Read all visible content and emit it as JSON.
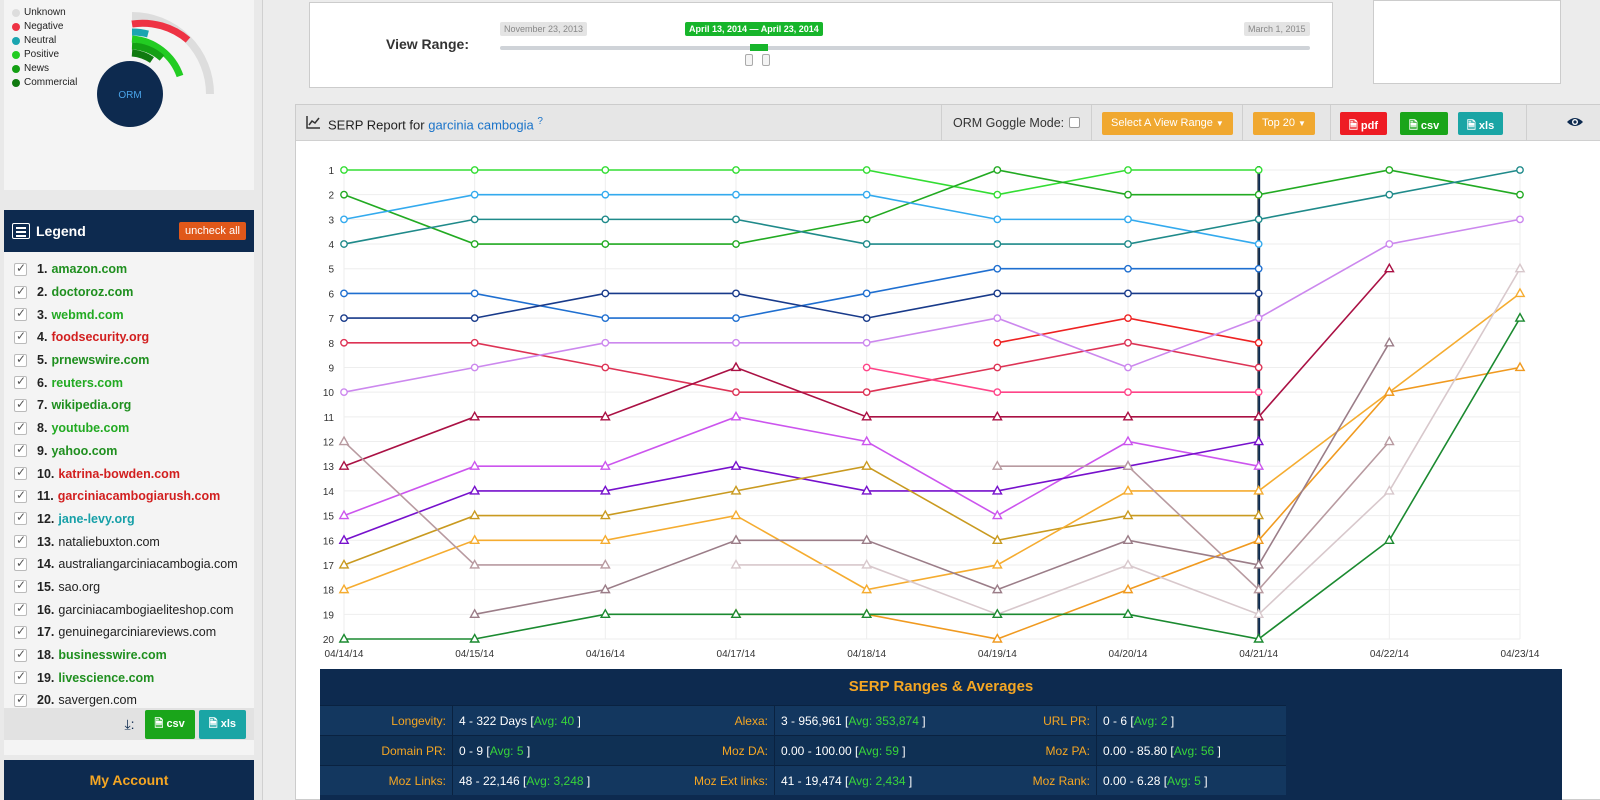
{
  "orm_legend": [
    {
      "label": "Unknown",
      "color": "#dddddd"
    },
    {
      "label": "Negative",
      "color": "#ee3344"
    },
    {
      "label": "Neutral",
      "color": "#1aa5b0"
    },
    {
      "label": "Positive",
      "color": "#22cc22"
    },
    {
      "label": "News",
      "color": "#14a014"
    },
    {
      "label": "Commercial",
      "color": "#107a10"
    }
  ],
  "orm_gauge_label": "ORM",
  "legend": {
    "title": "Legend",
    "uncheck_all": "uncheck all",
    "items": [
      {
        "num": "1.",
        "name": "amazon.com",
        "color": "#1f8f1f"
      },
      {
        "num": "2.",
        "name": "doctoroz.com",
        "color": "#1f8f1f"
      },
      {
        "num": "3.",
        "name": "webmd.com",
        "color": "#22aa22"
      },
      {
        "num": "4.",
        "name": "foodsecurity.org",
        "color": "#d21f1f"
      },
      {
        "num": "5.",
        "name": "prnewswire.com",
        "color": "#1f8f1f"
      },
      {
        "num": "6.",
        "name": "reuters.com",
        "color": "#22aa22"
      },
      {
        "num": "7.",
        "name": "wikipedia.org",
        "color": "#1f8f1f"
      },
      {
        "num": "8.",
        "name": "youtube.com",
        "color": "#22aa22"
      },
      {
        "num": "9.",
        "name": "yahoo.com",
        "color": "#1f8f1f"
      },
      {
        "num": "10.",
        "name": "katrina-bowden.com",
        "color": "#d21f1f"
      },
      {
        "num": "11.",
        "name": "garciniacambogiarush.com",
        "color": "#d21f1f"
      },
      {
        "num": "12.",
        "name": "jane-levy.org",
        "color": "#17a0a8"
      },
      {
        "num": "13.",
        "name": "nataliebuxton.com",
        "color": "plain"
      },
      {
        "num": "14.",
        "name": "australiangarciniacambogia.com",
        "color": "plain"
      },
      {
        "num": "15.",
        "name": "sao.org",
        "color": "plain"
      },
      {
        "num": "16.",
        "name": "garciniacambogiaeliteshop.com",
        "color": "plain"
      },
      {
        "num": "17.",
        "name": "genuinegarciniareviews.com",
        "color": "plain"
      },
      {
        "num": "18.",
        "name": "businesswire.com",
        "color": "#1f8f1f"
      },
      {
        "num": "19.",
        "name": "livescience.com",
        "color": "#1f8f1f"
      },
      {
        "num": "20.",
        "name": "savergen.com",
        "color": "plain"
      }
    ]
  },
  "export": {
    "csv": "csv",
    "xls": "xls"
  },
  "my_account": "My Account",
  "view_range": {
    "label": "View Range:",
    "start": "November 23, 2013",
    "end": "March 1, 2015",
    "selected": "April 13, 2014 — April 23, 2014"
  },
  "serp": {
    "title_prefix": "SERP Report for",
    "keyword": "garcinia cambogia",
    "help": "?",
    "goggle_mode": "ORM Goggle Mode:",
    "select_range": "Select A View Range",
    "top": "Top 20",
    "pdf": "pdf",
    "csv": "csv",
    "xls": "xls"
  },
  "chart_data": {
    "type": "line",
    "title": "",
    "y_reversed": true,
    "y_ticks": [
      1,
      2,
      3,
      4,
      5,
      6,
      7,
      8,
      9,
      10,
      11,
      12,
      13,
      14,
      15,
      16,
      17,
      18,
      19,
      20
    ],
    "categories": [
      "04/14/14",
      "04/15/14",
      "04/16/14",
      "04/17/14",
      "04/18/14",
      "04/19/14",
      "04/20/14",
      "04/21/14",
      "04/22/14",
      "04/23/14"
    ],
    "current_date_marker": "04/21/14",
    "series": [
      {
        "color": "#33dd33",
        "marker": "circle",
        "values": [
          1,
          1,
          1,
          1,
          1,
          2,
          1,
          1,
          null,
          null
        ]
      },
      {
        "color": "#22aa22",
        "marker": "circle",
        "values": [
          2,
          4,
          4,
          4,
          3,
          1,
          2,
          2,
          1,
          2
        ]
      },
      {
        "color": "#33aaee",
        "marker": "circle",
        "values": [
          3,
          2,
          2,
          2,
          2,
          3,
          3,
          4,
          null,
          null
        ]
      },
      {
        "color": "#1f8a8a",
        "marker": "circle",
        "values": [
          4,
          3,
          3,
          3,
          4,
          4,
          4,
          3,
          2,
          1
        ]
      },
      {
        "color": "#1f6fd0",
        "marker": "circle",
        "values": [
          6,
          6,
          7,
          7,
          6,
          5,
          5,
          5,
          null,
          null
        ]
      },
      {
        "color": "#183a8a",
        "marker": "circle",
        "values": [
          7,
          7,
          6,
          6,
          7,
          6,
          6,
          6,
          null,
          null
        ]
      },
      {
        "color": "#dd3355",
        "marker": "circle",
        "values": [
          8,
          8,
          9,
          10,
          10,
          9,
          8,
          9,
          null,
          null
        ]
      },
      {
        "color": "#ee2222",
        "marker": "circle",
        "values": [
          null,
          null,
          null,
          null,
          null,
          8,
          7,
          8,
          null,
          null
        ]
      },
      {
        "color": "#ff4488",
        "marker": "circle",
        "values": [
          null,
          null,
          null,
          null,
          9,
          10,
          10,
          10,
          null,
          null
        ]
      },
      {
        "color": "#cc88ee",
        "marker": "circle",
        "values": [
          10,
          9,
          8,
          8,
          8,
          7,
          9,
          7,
          4,
          3
        ]
      },
      {
        "color": "#aa1144",
        "marker": "triangle",
        "values": [
          13,
          11,
          11,
          9,
          11,
          11,
          11,
          11,
          5,
          null
        ]
      },
      {
        "color": "#cc55ee",
        "marker": "triangle",
        "values": [
          15,
          13,
          13,
          11,
          12,
          15,
          12,
          13,
          null,
          null
        ]
      },
      {
        "color": "#7711cc",
        "marker": "triangle",
        "values": [
          16,
          14,
          14,
          13,
          14,
          14,
          13,
          12,
          null,
          null
        ]
      },
      {
        "color": "#c99a20",
        "marker": "triangle",
        "values": [
          17,
          15,
          15,
          14,
          13,
          16,
          15,
          15,
          null,
          null
        ]
      },
      {
        "color": "#f5ac30",
        "marker": "triangle",
        "values": [
          18,
          16,
          16,
          15,
          18,
          17,
          14,
          14,
          10,
          6
        ]
      },
      {
        "color": "#f09a20",
        "marker": "triangle",
        "values": [
          null,
          null,
          null,
          19,
          19,
          20,
          18,
          16,
          10,
          9
        ]
      },
      {
        "color": "#b89aa0",
        "marker": "triangle",
        "values": [
          12,
          17,
          17,
          null,
          null,
          13,
          13,
          18,
          12,
          null
        ]
      },
      {
        "color": "#9b7d88",
        "marker": "triangle",
        "values": [
          null,
          19,
          18,
          16,
          16,
          18,
          16,
          17,
          8,
          null
        ]
      },
      {
        "color": "#d8c8cc",
        "marker": "triangle",
        "values": [
          null,
          null,
          null,
          17,
          17,
          19,
          17,
          19,
          14,
          5
        ]
      },
      {
        "color": "#1b8a30",
        "marker": "triangle",
        "values": [
          20,
          20,
          19,
          19,
          19,
          19,
          19,
          20,
          16,
          7
        ]
      }
    ]
  },
  "ranges": {
    "title": "SERP Ranges & Averages",
    "rows": [
      [
        {
          "label": "Longevity:",
          "value": "4 - 322 Days [",
          "avg": "Avg: 40",
          "close": " ]"
        },
        {
          "label": "Alexa:",
          "value": "3 - 956,961 [",
          "avg": "Avg: 353,874",
          "close": " ]"
        },
        {
          "label": "URL PR:",
          "value": "0 - 6 [",
          "avg": "Avg: 2",
          "close": " ]"
        }
      ],
      [
        {
          "label": "Domain PR:",
          "value": "0 - 9 [",
          "avg": "Avg: 5",
          "close": " ]"
        },
        {
          "label": "Moz DA:",
          "value": "0.00 - 100.00 [",
          "avg": "Avg: 59",
          "close": " ]"
        },
        {
          "label": "Moz PA:",
          "value": "0.00 - 85.80 [",
          "avg": "Avg: 56",
          "close": " ]"
        }
      ],
      [
        {
          "label": "Moz Links:",
          "value": "48 - 22,146 [",
          "avg": "Avg: 3,248",
          "close": " ]"
        },
        {
          "label": "Moz Ext links:",
          "value": "41 - 19,474 [",
          "avg": "Avg: 2,434",
          "close": " ]"
        },
        {
          "label": "Moz Rank:",
          "value": "0.00 - 6.28 [",
          "avg": "Avg: 5",
          "close": " ]"
        }
      ]
    ]
  }
}
